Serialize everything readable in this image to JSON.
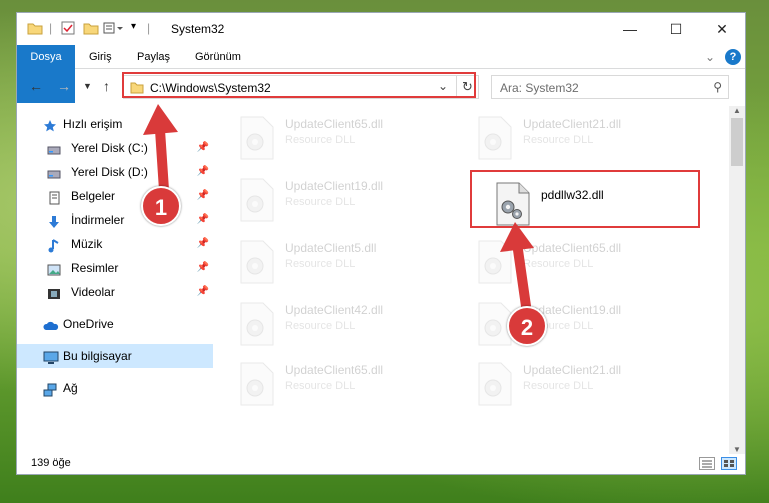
{
  "window": {
    "title": "System32",
    "accent": "#1979ca"
  },
  "ribbon": {
    "tabs": [
      "Dosya",
      "Giriş",
      "Paylaş",
      "Görünüm"
    ]
  },
  "address": {
    "path": "C:\\Windows\\System32"
  },
  "search": {
    "placeholder": "Ara: System32"
  },
  "sidebar": {
    "items": [
      {
        "label": "Hızlı erişim",
        "icon": "star-icon"
      },
      {
        "label": "Yerel Disk (C:)",
        "icon": "drive-icon",
        "pinned": true
      },
      {
        "label": "Yerel Disk (D:)",
        "icon": "drive-icon",
        "pinned": true
      },
      {
        "label": "Belgeler",
        "icon": "documents-icon",
        "pinned": true
      },
      {
        "label": "İndirmeler",
        "icon": "download-icon",
        "pinned": true
      },
      {
        "label": "Müzik",
        "icon": "music-icon",
        "pinned": true
      },
      {
        "label": "Resimler",
        "icon": "pictures-icon",
        "pinned": true
      },
      {
        "label": "Videolar",
        "icon": "videos-icon",
        "pinned": true
      },
      {
        "label": "OneDrive",
        "icon": "cloud-icon"
      },
      {
        "label": "Bu bilgisayar",
        "icon": "computer-icon",
        "selected": true
      },
      {
        "label": "Ağ",
        "icon": "network-icon"
      }
    ]
  },
  "files": [
    {
      "name": "UpdateClient65.dll",
      "type": "Resource DLL"
    },
    {
      "name": "UpdateClient21.dll",
      "type": "Resource DLL"
    },
    {
      "name": "UpdateClient19.dll",
      "type": "Resource DLL"
    },
    {
      "name": "pddllw32.dll",
      "type": ""
    },
    {
      "name": "UpdateClient5.dll",
      "type": "Resource DLL"
    },
    {
      "name": "UpdateClient65.dll",
      "type": "Resource DLL"
    },
    {
      "name": "UpdateClient42.dll",
      "type": "Resource DLL"
    },
    {
      "name": "UpdateClient19.dll",
      "type": "Resource DLL"
    },
    {
      "name": "UpdateClient65.dll",
      "type": "Resource DLL"
    },
    {
      "name": "UpdateClient21.dll",
      "type": "Resource DLL"
    }
  ],
  "status": {
    "count": "139 öğe"
  },
  "callouts": {
    "one": "1",
    "two": "2",
    "color": "#d93a3a"
  }
}
